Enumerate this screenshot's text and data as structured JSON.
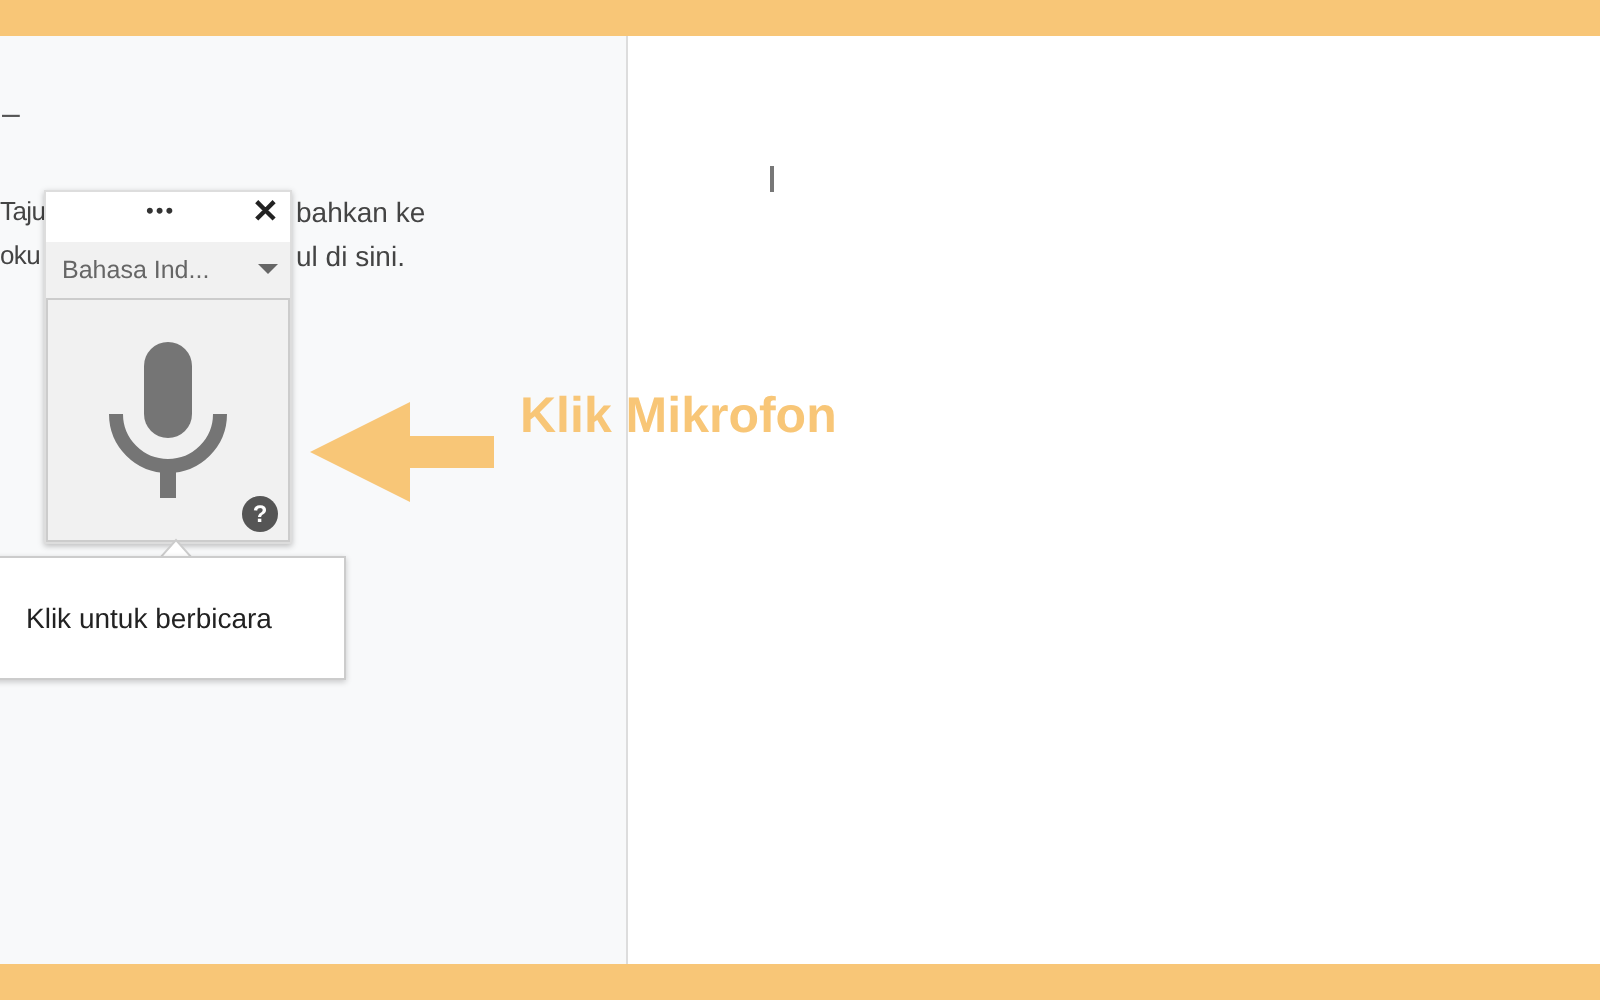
{
  "panel": {
    "dash": "–",
    "lines": [
      {
        "left": "Taju",
        "right": "bahkan ke"
      },
      {
        "left": "oku",
        "right": "ul di sini."
      }
    ]
  },
  "voice_popup": {
    "menu": "•••",
    "close": "✕",
    "language": "Bahasa Ind...",
    "help": "?"
  },
  "tooltip": "Klik untuk berbicara",
  "annotation": "Klik Mikrofon"
}
